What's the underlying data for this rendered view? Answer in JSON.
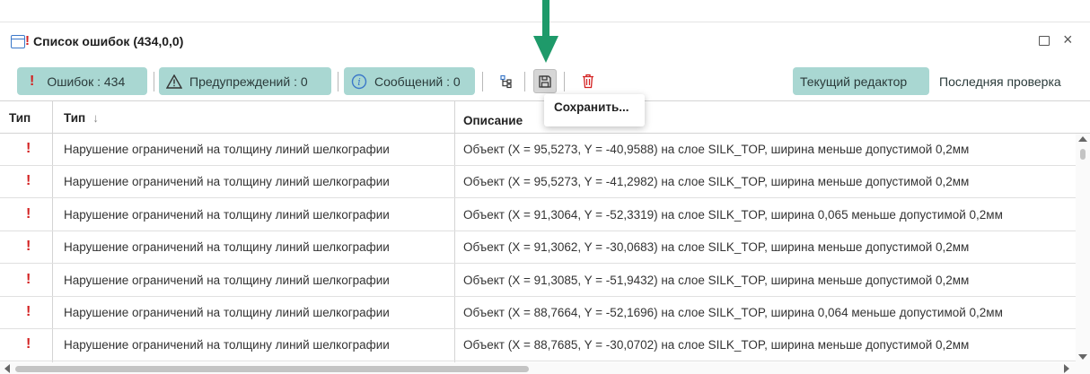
{
  "window": {
    "title": "Список ошибок (434,0,0)",
    "maximize_icon": "maximize-icon",
    "close_label": "×"
  },
  "toolbar": {
    "errors_label": "Ошибок : 434",
    "warnings_label": "Предупреждений : 0",
    "messages_label": "Сообщений : 0",
    "current_editor_label": "Текущий редактор",
    "last_check_label": "Последняя проверка"
  },
  "tooltip": {
    "text": "Сохранить..."
  },
  "table": {
    "columns": [
      "Тип",
      "Тип",
      "Описание"
    ],
    "sort_indicator": "↓",
    "rows": [
      {
        "severity": "!",
        "type": "Нарушение ограничений на толщину линий шелкографии",
        "description": "Объект (X = 95,5273, Y = -40,9588) на слое SILK_TOP, ширина меньше допустимой 0,2мм"
      },
      {
        "severity": "!",
        "type": "Нарушение ограничений на толщину линий шелкографии",
        "description": "Объект (X = 95,5273, Y = -41,2982) на слое SILK_TOP, ширина меньше допустимой 0,2мм"
      },
      {
        "severity": "!",
        "type": "Нарушение ограничений на толщину линий шелкографии",
        "description": "Объект (X = 91,3064, Y = -52,3319) на слое SILK_TOP, ширина 0,065 меньше допустимой 0,2мм"
      },
      {
        "severity": "!",
        "type": "Нарушение ограничений на толщину линий шелкографии",
        "description": "Объект (X = 91,3062, Y = -30,0683) на слое SILK_TOP, ширина меньше допустимой 0,2мм"
      },
      {
        "severity": "!",
        "type": "Нарушение ограничений на толщину линий шелкографии",
        "description": "Объект (X = 91,3085, Y = -51,9432) на слое SILK_TOP, ширина меньше допустимой 0,2мм"
      },
      {
        "severity": "!",
        "type": "Нарушение ограничений на толщину линий шелкографии",
        "description": "Объект (X = 88,7664, Y = -52,1696) на слое SILK_TOP, ширина 0,064 меньше допустимой 0,2мм"
      },
      {
        "severity": "!",
        "type": "Нарушение ограничений на толщину линий шелкографии",
        "description": "Объект (X = 88,7685, Y = -30,0702) на слое SILK_TOP, ширина меньше допустимой 0,2мм"
      }
    ]
  },
  "colors": {
    "chip_bg": "#a9d7d2",
    "error_red": "#d32020",
    "info_blue": "#3b78c9",
    "arrow_green": "#1e9a6a"
  }
}
